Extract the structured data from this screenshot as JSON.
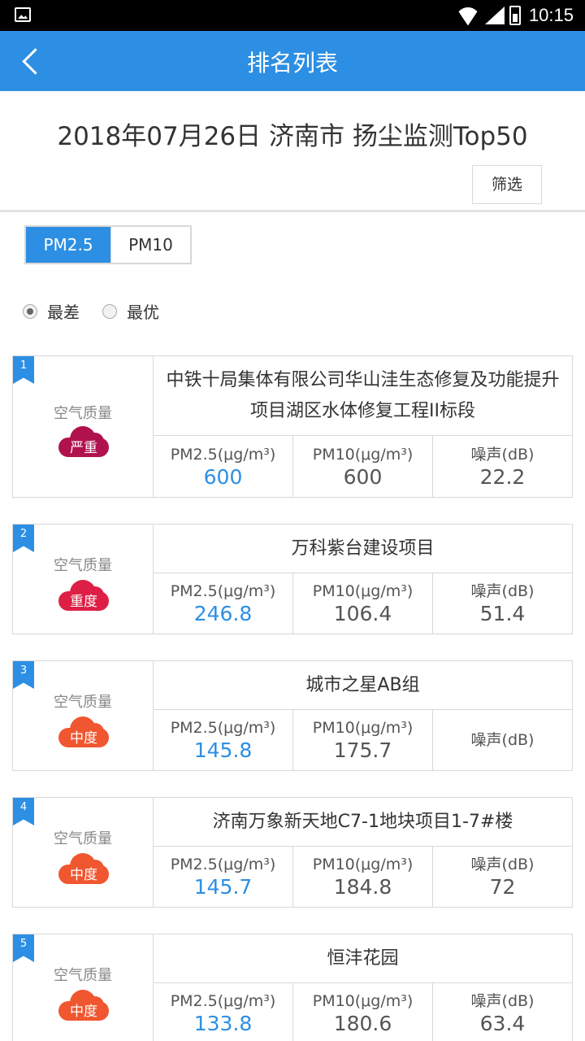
{
  "status_bar": {
    "time": "10:15",
    "icons": [
      "image-icon",
      "wifi-icon",
      "signal-icon",
      "battery-icon"
    ]
  },
  "app_bar": {
    "title": "排名列表",
    "back_icon": "back-arrow-icon"
  },
  "heading": "2018年07月26日 济南市 扬尘监测Top50",
  "filter_label": "筛选",
  "tabs": [
    {
      "label": "PM2.5",
      "active": true
    },
    {
      "label": "PM10",
      "active": false
    }
  ],
  "radios": [
    {
      "label": "最差",
      "checked": true
    },
    {
      "label": "最优",
      "checked": false
    }
  ],
  "colors": {
    "primary": "#2d8fe3",
    "severe": "#b0124e",
    "heavy": "#dd1f45",
    "moderate": "#f0562f"
  },
  "labels": {
    "air_quality": "空气质量",
    "pm25_unit": "PM2.5(μg/m³)",
    "pm10_unit": "PM10(μg/m³)",
    "noise_unit": "噪声(dB)"
  },
  "items": [
    {
      "rank": "1",
      "level": "严重",
      "level_color": "#b0124e",
      "name": "中铁十局集体有限公司华山洼生态修复及功能提升项目湖区水体修复工程II标段",
      "pm25": "600",
      "pm10": "600",
      "noise": "22.2"
    },
    {
      "rank": "2",
      "level": "重度",
      "level_color": "#dd1f45",
      "name": "万科紫台建设项目",
      "pm25": "246.8",
      "pm10": "106.4",
      "noise": "51.4"
    },
    {
      "rank": "3",
      "level": "中度",
      "level_color": "#f0562f",
      "name": "城市之星AB组",
      "pm25": "145.8",
      "pm10": "175.7",
      "noise": ""
    },
    {
      "rank": "4",
      "level": "中度",
      "level_color": "#f0562f",
      "name": "济南万象新天地C7-1地块项目1-7#楼",
      "pm25": "145.7",
      "pm10": "184.8",
      "noise": "72"
    },
    {
      "rank": "5",
      "level": "中度",
      "level_color": "#f0562f",
      "name": "恒沣花园",
      "pm25": "133.8",
      "pm10": "180.6",
      "noise": "63.4"
    }
  ]
}
